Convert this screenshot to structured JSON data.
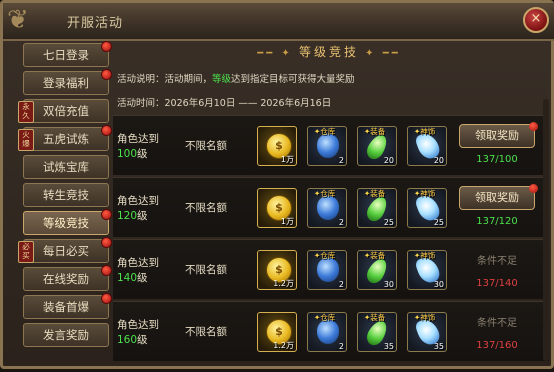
{
  "window": {
    "title": "开服活动",
    "close_label": "×"
  },
  "sidebar": {
    "items": [
      {
        "label": "七日登录",
        "dot": true,
        "badge": ""
      },
      {
        "label": "登录福利",
        "dot": true,
        "badge": ""
      },
      {
        "label": "双倍充值",
        "dot": false,
        "badge": "永久"
      },
      {
        "label": "五虎试炼",
        "dot": true,
        "badge": "火爆"
      },
      {
        "label": "试炼宝库",
        "dot": false,
        "badge": ""
      },
      {
        "label": "转生竞技",
        "dot": false,
        "badge": ""
      },
      {
        "label": "等级竞技",
        "dot": true,
        "badge": "",
        "active": true
      },
      {
        "label": "每日必买",
        "dot": true,
        "badge": "必买"
      },
      {
        "label": "在线奖励",
        "dot": true,
        "badge": ""
      },
      {
        "label": "装备首爆",
        "dot": true,
        "badge": ""
      },
      {
        "label": "发言奖励",
        "dot": false,
        "badge": ""
      }
    ]
  },
  "main": {
    "header": "等级竞技",
    "desc_prefix": "活动说明：活动期间，",
    "desc_highlight": "等级",
    "desc_suffix": "达到指定目标可获得大量奖励",
    "time_label": "活动时间：",
    "time_start": "2026年6月10日",
    "time_sep": "——",
    "time_end": "2026年6月16日"
  },
  "rows": [
    {
      "cond_line1": "角色达到",
      "level": "100",
      "level_unit": "级",
      "limit": "不限名额",
      "rewards": [
        {
          "qty": "1万"
        },
        {
          "tag": "仓库",
          "qty": "2"
        },
        {
          "tag": "装备",
          "qty": "20"
        },
        {
          "tag": "神饰",
          "qty": "20"
        }
      ],
      "button": "领取奖励",
      "status": "",
      "progress": "137/100",
      "ok": true
    },
    {
      "cond_line1": "角色达到",
      "level": "120",
      "level_unit": "级",
      "limit": "不限名额",
      "rewards": [
        {
          "qty": "1万"
        },
        {
          "tag": "仓库",
          "qty": "2"
        },
        {
          "tag": "装备",
          "qty": "25"
        },
        {
          "tag": "神饰",
          "qty": "25"
        }
      ],
      "button": "领取奖励",
      "status": "",
      "progress": "137/120",
      "ok": true
    },
    {
      "cond_line1": "角色达到",
      "level": "140",
      "level_unit": "级",
      "limit": "不限名额",
      "rewards": [
        {
          "qty": "1.2万"
        },
        {
          "tag": "仓库",
          "qty": "2"
        },
        {
          "tag": "装备",
          "qty": "30"
        },
        {
          "tag": "神饰",
          "qty": "30"
        }
      ],
      "button": "",
      "status": "条件不足",
      "progress": "137/140",
      "ok": false
    },
    {
      "cond_line1": "角色达到",
      "level": "160",
      "level_unit": "级",
      "limit": "不限名额",
      "rewards": [
        {
          "qty": "1.2万"
        },
        {
          "tag": "仓库",
          "qty": "2"
        },
        {
          "tag": "装备",
          "qty": "35"
        },
        {
          "tag": "神饰",
          "qty": "35"
        }
      ],
      "button": "",
      "status": "条件不足",
      "progress": "137/160",
      "ok": false
    }
  ]
}
